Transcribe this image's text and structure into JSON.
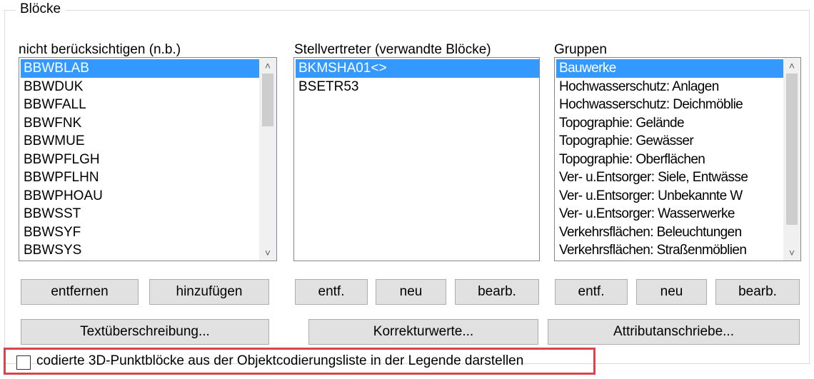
{
  "group": {
    "title": "Blöcke"
  },
  "not_considered": {
    "label": "nicht berücksichtigen (n.b.)",
    "items": [
      "BBWBLAB",
      "BBWDUK",
      "BBWFALL",
      "BBWFNK",
      "BBWMUE",
      "BBWPFLGH",
      "BBWPFLHN",
      "BBWPHOAU",
      "BBWSST",
      "BBWSYF",
      "BBWSYS"
    ],
    "selected": "BBWBLAB"
  },
  "proxies": {
    "label": "Stellvertreter (verwandte Blöcke)",
    "items": [
      "BKMSHA01<>",
      "BSETR53"
    ],
    "selected": "BKMSHA01<>"
  },
  "groups": {
    "label": "Gruppen",
    "items": [
      "Bauwerke",
      "Hochwasserschutz: Anlagen",
      "Hochwasserschutz: Deichmöblie",
      "Topographie: Gelände",
      "Topographie: Gewässer",
      "Topographie: Oberflächen",
      "Ver- u.Entsorger: Siele, Entwässe",
      "Ver- u.Entsorger: Unbekannte W",
      "Ver- u.Entsorger: Wasserwerke",
      "Verkehrsflächen: Beleuchtungen",
      "Verkehrsflächen: Straßenmöblien"
    ],
    "selected": "Bauwerke"
  },
  "buttons": {
    "remove": "entfernen",
    "add": "hinzufügen",
    "proxy_delete": "entf.",
    "proxy_new": "neu",
    "proxy_edit": "bearb.",
    "group_delete": "entf.",
    "group_new": "neu",
    "group_edit": "bearb.",
    "text_override": "Textüberschreibung...",
    "correction_values": "Korrekturwerte...",
    "attribute_labels": "Attributanschriebe..."
  },
  "legend_option": {
    "label": "codierte 3D-Punktblöcke aus der Objektcodierungsliste in der Legende darstellen",
    "checked": false
  },
  "icons": {
    "scroll_up": "chevron-up-icon",
    "scroll_down": "chevron-down-icon"
  }
}
